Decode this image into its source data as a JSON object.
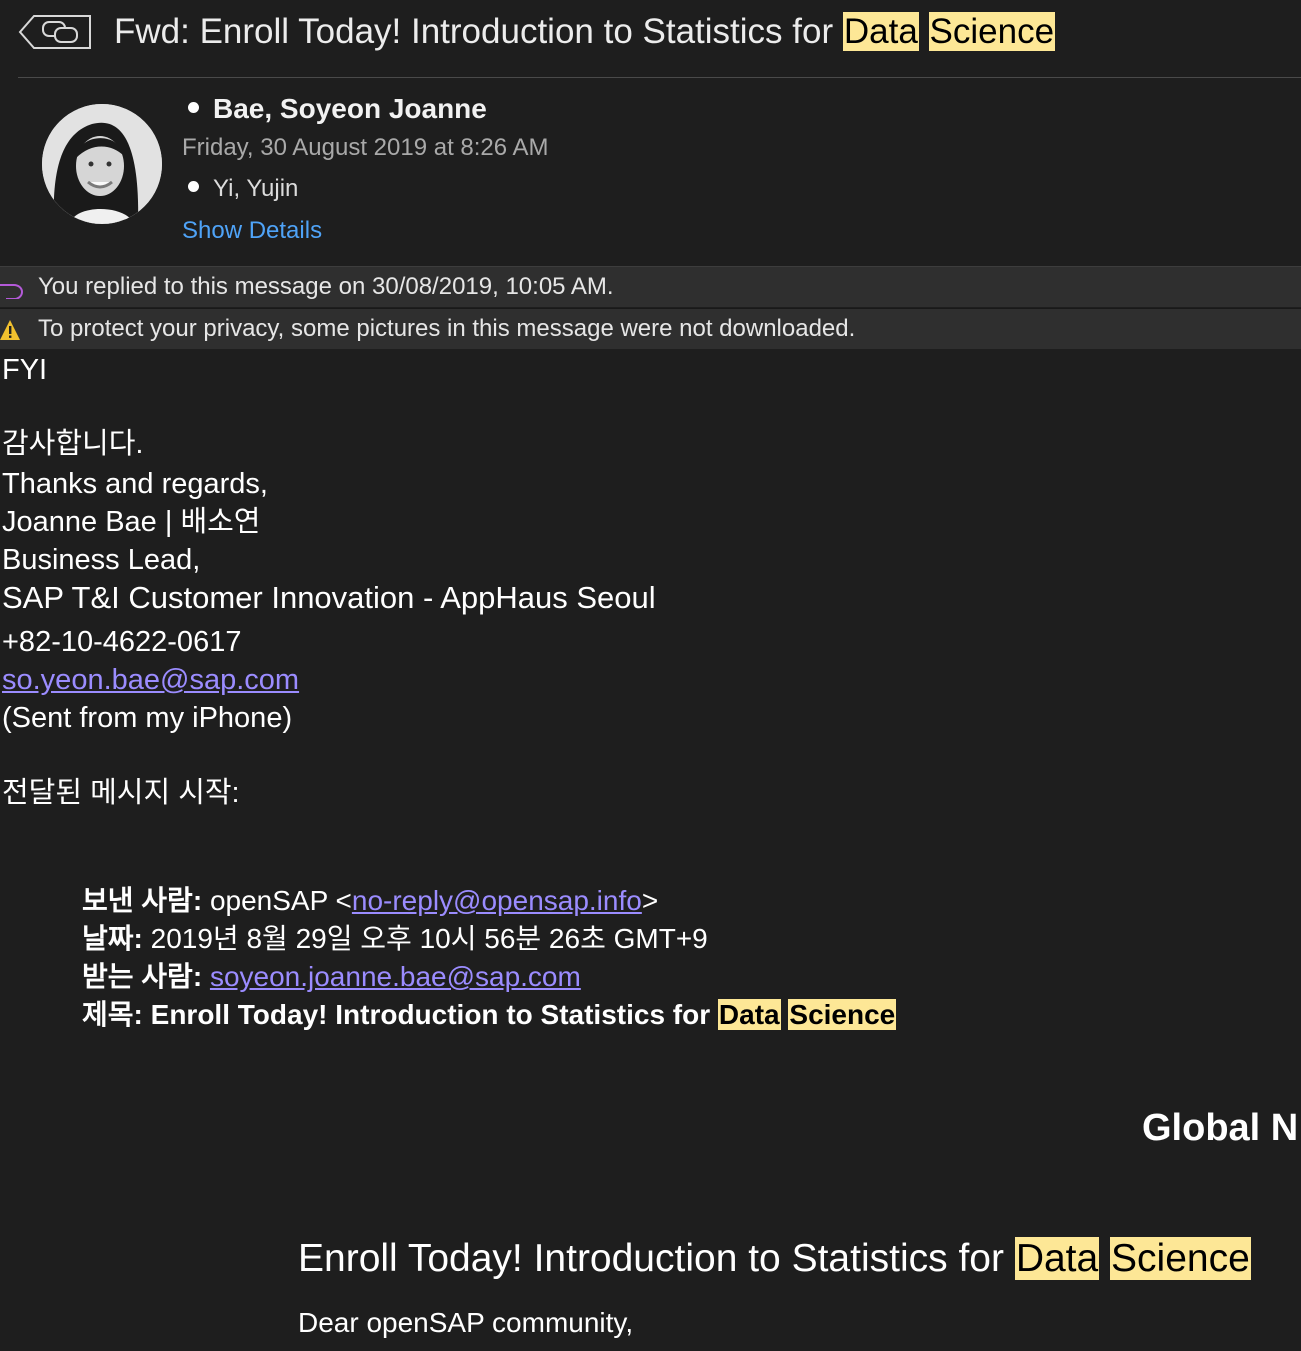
{
  "header": {
    "subject_prefix": "Fwd: Enroll Today! Introduction to Statistics for",
    "subject_highlight_1": "Data",
    "subject_highlight_2": "Science",
    "sender": "Bae, Soyeon Joanne",
    "date": "Friday, 30 August 2019 at 8:26 AM",
    "recipient": "Yi, Yujin",
    "show_details": "Show Details"
  },
  "banners": {
    "replied": "You replied to this message on 30/08/2019, 10:05 AM.",
    "privacy": "To protect your privacy, some pictures in this message were not downloaded."
  },
  "body": {
    "fyi": "FYI",
    "thanks_kr": "감사합니다.",
    "thanks_en": "Thanks and regards,",
    "name": "Joanne Bae | 배소연",
    "title": "Business Lead,",
    "org": "SAP T&I Customer Innovation - AppHaus Seoul",
    "phone": "+82-10-4622-0617",
    "email": "so.yeon.bae@sap.com",
    "sent_from": "(Sent from my iPhone)",
    "forwarded_start": "전달된 메시지 시작:"
  },
  "forwarded": {
    "from_label": "보낸 사람:",
    "from_name": "openSAP <",
    "from_email": "no-reply@opensap.info",
    "from_close": ">",
    "date_label": "날짜:",
    "date_value": "2019년 8월 29일 오후 10시 56분 26초 GMT+9",
    "to_label": "받는 사람:",
    "to_email": "soyeon.joanne.bae@sap.com",
    "subject_label": "제목:",
    "subject_prefix": "Enroll Today! Introduction to Statistics for",
    "subject_highlight_1": "Data",
    "subject_highlight_2": "Science"
  },
  "content": {
    "global_partial": "Global N",
    "enroll_prefix": "Enroll Today! Introduction to Statistics for",
    "enroll_highlight_1": "Data",
    "enroll_highlight_2": "Science",
    "greeting": "Dear openSAP community,"
  },
  "colors": {
    "background": "#1e1e1e",
    "highlight": "#fde796",
    "link": "#9b8cff",
    "show_details": "#4fa3f7"
  }
}
